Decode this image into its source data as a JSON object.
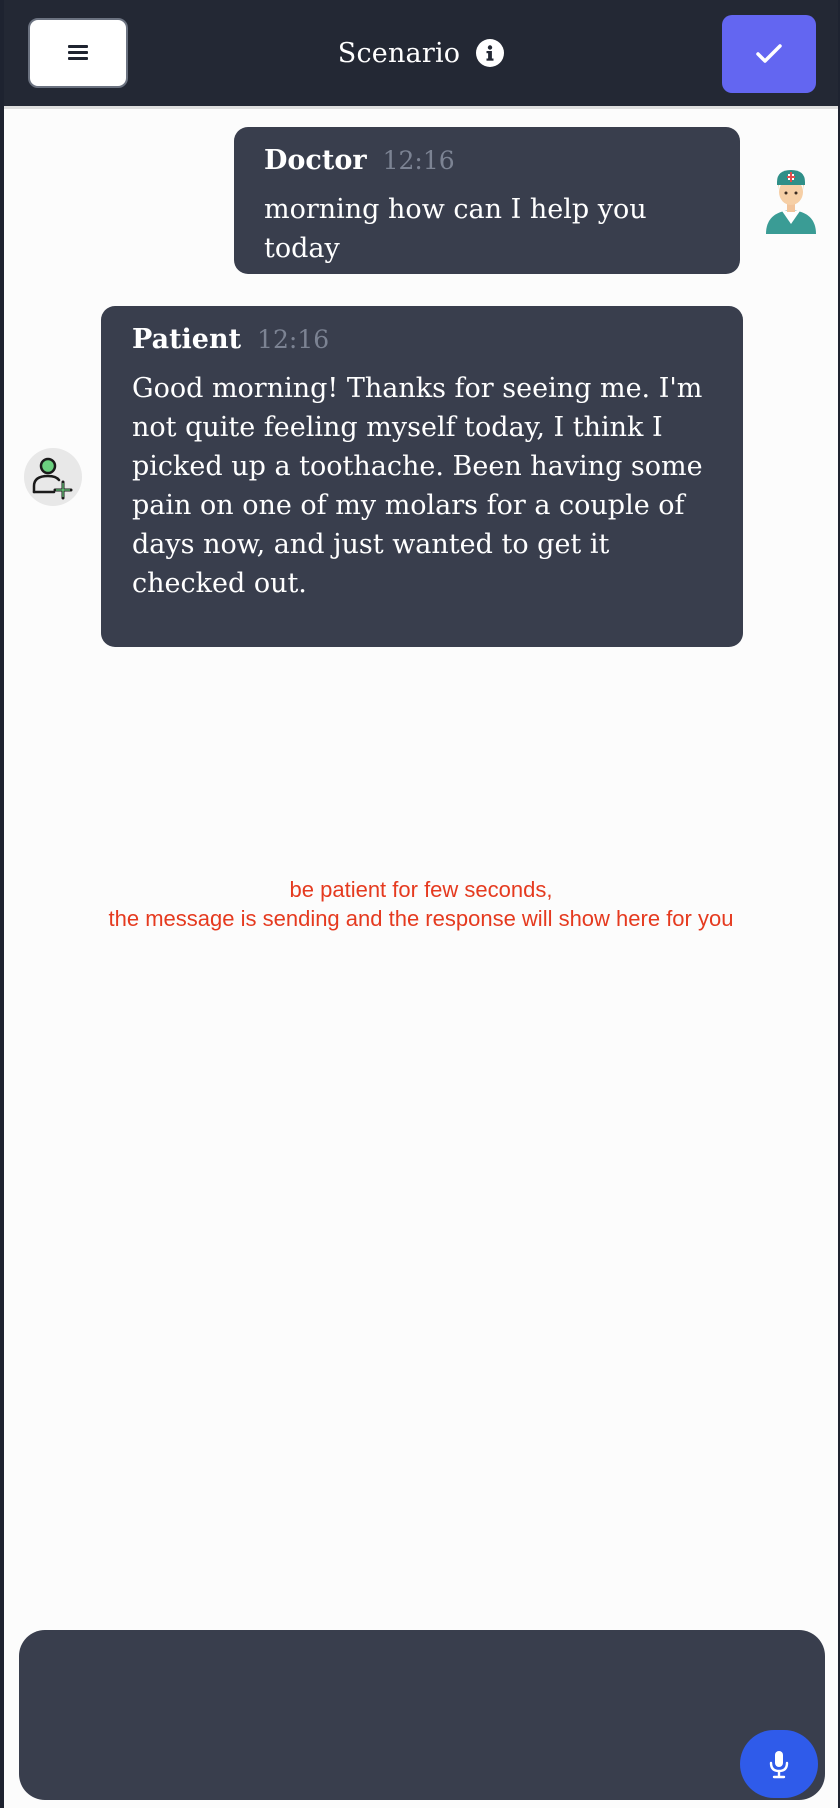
{
  "header": {
    "title": "Scenario",
    "menu_icon": "hamburger-menu-icon",
    "info_icon": "info-circle-icon",
    "confirm_icon": "checkmark-icon"
  },
  "messages": [
    {
      "sender": "Doctor",
      "time": "12:16",
      "text": "morning how can I help you today",
      "avatar": "doctor-avatar-icon"
    },
    {
      "sender": "Patient",
      "time": "12:16",
      "text": "Good morning! Thanks for seeing me. I'm not quite feeling myself today, I think I picked up a toothache. Been having some pain on one of my molars for a couple of days now, and just wanted to get it checked out.",
      "avatar": "add-user-icon"
    }
  ],
  "status": {
    "line1": "be patient for few seconds,",
    "line2": "the message is sending and the response will show here for you"
  },
  "composer": {
    "value": "",
    "mic_icon": "microphone-icon"
  },
  "colors": {
    "header_bg": "#232834",
    "accent": "#6366f1",
    "bubble_bg": "#393e4d",
    "status_text": "#e53a1f",
    "mic_button": "#2f5bea"
  }
}
